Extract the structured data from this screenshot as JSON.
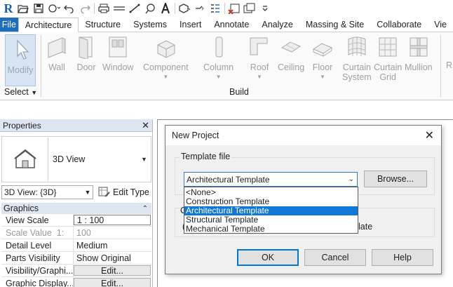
{
  "app": {
    "logo_letter": "R",
    "quick_access_icons": [
      "open-icon",
      "save-icon",
      "sync-icon",
      "undo-icon",
      "redo-icon",
      "print-icon",
      "measure-icon",
      "dimension-icon",
      "tag-icon",
      "text-icon",
      "3d-view-icon",
      "section-icon",
      "thin-lines-icon",
      "close-hidden-icon",
      "switch-windows-icon",
      "customize-icon"
    ]
  },
  "tabs": [
    {
      "label": "File"
    },
    {
      "label": "Architecture"
    },
    {
      "label": "Structure"
    },
    {
      "label": "Systems"
    },
    {
      "label": "Insert"
    },
    {
      "label": "Annotate"
    },
    {
      "label": "Analyze"
    },
    {
      "label": "Massing & Site"
    },
    {
      "label": "Collaborate"
    },
    {
      "label": "Vie"
    }
  ],
  "ribbon": {
    "modify": "Modify",
    "select_panel": "Select",
    "build_panel": "Build",
    "tools": [
      {
        "label": "Wall",
        "label2": ""
      },
      {
        "label": "Door",
        "label2": ""
      },
      {
        "label": "Window",
        "label2": ""
      },
      {
        "label": "Component",
        "label2": ""
      },
      {
        "label": "Column",
        "label2": ""
      },
      {
        "label": "Roof",
        "label2": ""
      },
      {
        "label": "Ceiling",
        "label2": ""
      },
      {
        "label": "Floor",
        "label2": ""
      },
      {
        "label": "Curtain",
        "label2": "System"
      },
      {
        "label": "Curtain",
        "label2": "Grid"
      },
      {
        "label": "Mullion",
        "label2": ""
      }
    ],
    "cut_label": "R"
  },
  "properties": {
    "title": "Properties",
    "type_name": "3D View",
    "instance_selector": "3D View: {3D}",
    "edit_type": "Edit Type",
    "group": "Graphics",
    "rows": [
      {
        "key": "View Scale",
        "value": "1 : 100"
      },
      {
        "key": "Scale Value",
        "key2": "1:",
        "value": "100"
      },
      {
        "key": "Detail Level",
        "value": "Medium"
      },
      {
        "key": "Parts Visibility",
        "value": "Show Original"
      },
      {
        "key": "Visibility/Graphi...",
        "value": "Edit..."
      },
      {
        "key": "Graphic Display...",
        "value": "Edit..."
      }
    ]
  },
  "dialog": {
    "title": "New Project",
    "template_group": "Template file",
    "selected_template": "Architectural Template",
    "browse": "Browse...",
    "options": [
      "<None>",
      "Construction Template",
      "Architectural Template",
      "Structural Template",
      "Mechanical Template"
    ],
    "hidden_group_fragment": "C",
    "hidden_radio_fragment": "(",
    "hidden_radio_label_fragment": "late",
    "ok": "OK",
    "cancel": "Cancel",
    "help": "Help"
  },
  "colors": {
    "file_tab": "#1e6ebd",
    "selection": "#0f78d7",
    "panel_header": "#dde6f0"
  }
}
